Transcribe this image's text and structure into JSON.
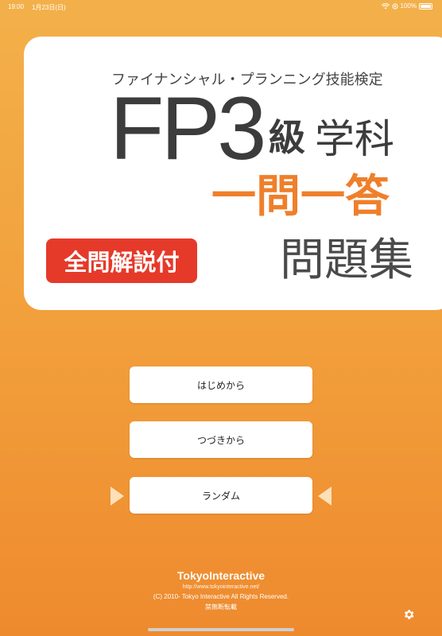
{
  "status_bar": {
    "time": "19:00",
    "date": "1月23日(日)",
    "battery": "100%"
  },
  "title": {
    "subtitle": "ファイナンシャル・プランニング技能検定",
    "main": "FP3",
    "grade": "級",
    "subject": "学科",
    "type": "一問一答",
    "collection": "問題集",
    "badge": "全問解説付"
  },
  "menu": {
    "start": "はじめから",
    "continue": "つづきから",
    "random": "ランダム"
  },
  "footer": {
    "brand": "TokyoInteractive",
    "url": "http://www.tokyointeractive.net/",
    "copyright": "(C) 2010- Tokyo Interactive All Rights Reserved.",
    "notice": "禁無断転載"
  },
  "icons": {
    "settings": "gear-icon",
    "wifi": "wifi-icon",
    "battery": "battery-icon"
  },
  "colors": {
    "background_top": "#f3b04a",
    "background_bottom": "#ee8a2e",
    "accent_orange": "#ef7f2a",
    "badge_red": "#e53a2a",
    "title_gray": "#3c3c3c"
  }
}
